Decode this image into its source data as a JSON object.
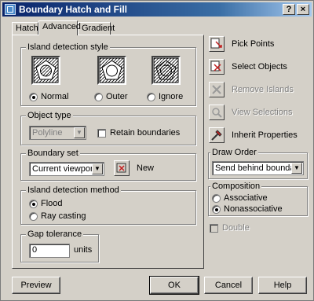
{
  "window": {
    "title": "Boundary Hatch and Fill",
    "help_button": "?",
    "close_button": "×"
  },
  "tabs": [
    {
      "label": "Hatch"
    },
    {
      "label": "Advanced"
    },
    {
      "label": "Gradient"
    }
  ],
  "island_detection_style": {
    "label": "Island detection style",
    "options": [
      {
        "label": "Normal"
      },
      {
        "label": "Outer"
      },
      {
        "label": "Ignore"
      }
    ],
    "selected": "Normal"
  },
  "object_type": {
    "label": "Object type",
    "value": "Polyline",
    "retain_boundaries_label": "Retain boundaries",
    "retain_boundaries_checked": false
  },
  "boundary_set": {
    "label": "Boundary set",
    "value": "Current viewport",
    "new_label": "New"
  },
  "island_detection_method": {
    "label": "Island detection method",
    "options": [
      {
        "label": "Flood"
      },
      {
        "label": "Ray casting"
      }
    ],
    "selected": "Flood"
  },
  "gap_tolerance": {
    "label": "Gap tolerance",
    "value": "0",
    "units_label": "units"
  },
  "side_actions": [
    {
      "label": "Pick Points",
      "enabled": true,
      "icon": "pick-points-icon"
    },
    {
      "label": "Select Objects",
      "enabled": true,
      "icon": "select-objects-icon"
    },
    {
      "label": "Remove Islands",
      "enabled": false,
      "icon": "remove-islands-icon"
    },
    {
      "label": "View Selections",
      "enabled": false,
      "icon": "view-selections-icon"
    },
    {
      "label": "Inherit Properties",
      "enabled": true,
      "icon": "inherit-properties-icon"
    }
  ],
  "draw_order": {
    "label": "Draw Order",
    "value": "Send behind boundary"
  },
  "composition": {
    "label": "Composition",
    "options": [
      {
        "label": "Associative"
      },
      {
        "label": "Nonassociative"
      }
    ],
    "selected": "Nonassociative"
  },
  "double": {
    "label": "Double",
    "enabled": false,
    "checked": false
  },
  "footer": {
    "preview": "Preview",
    "ok": "OK",
    "cancel": "Cancel",
    "help": "Help"
  },
  "colors": {
    "title_start": "#0a246a",
    "title_end": "#a6caf0",
    "face": "#d4d0c8",
    "icon_red": "#c02020"
  }
}
